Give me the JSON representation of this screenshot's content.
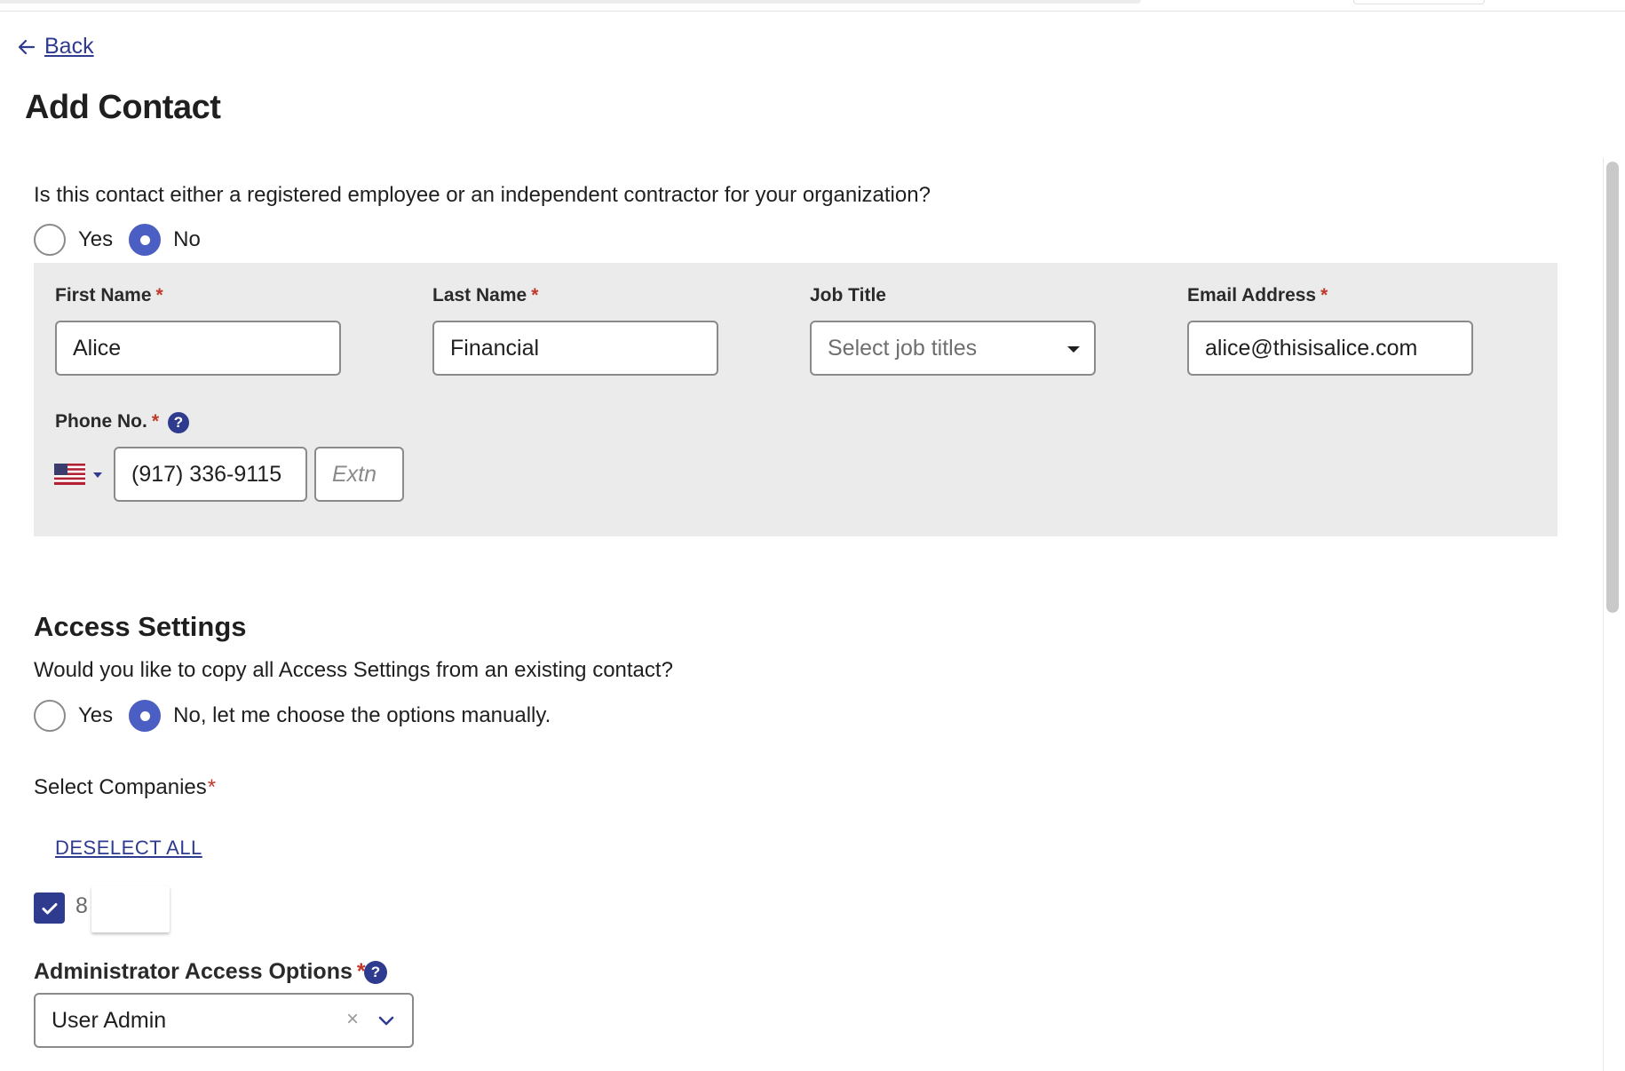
{
  "nav": {
    "back_label": "Back"
  },
  "page": {
    "title": "Add Contact"
  },
  "employee_question": {
    "text": "Is this contact either a registered employee or an independent contractor for your organization?",
    "options": [
      {
        "label": "Yes",
        "selected": false
      },
      {
        "label": "No",
        "selected": true
      }
    ]
  },
  "contact_form": {
    "first_name": {
      "label": "First Name",
      "required_mark": "*",
      "value": "Alice"
    },
    "last_name": {
      "label": "Last Name",
      "required_mark": "*",
      "value": "Financial"
    },
    "job_title": {
      "label": "Job Title",
      "placeholder": "Select job titles"
    },
    "email": {
      "label": "Email Address",
      "required_mark": "*",
      "value": "alice@thisisalice.com"
    },
    "phone": {
      "label": "Phone No.",
      "required_mark": "*",
      "help_icon": "?",
      "country_flag": "us-flag-icon",
      "value": "(917) 336-9115",
      "extension_placeholder": "Extn"
    }
  },
  "access_settings": {
    "heading": "Access Settings",
    "copy_question": "Would you like to copy all Access Settings from an existing contact?",
    "copy_options": [
      {
        "label": "Yes",
        "selected": false
      },
      {
        "label": "No, let me choose the options manually.",
        "selected": true
      }
    ],
    "companies": {
      "label": "Select Companies",
      "required_mark": "*",
      "deselect_all": "DESELECT ALL",
      "items": [
        {
          "text": "8",
          "checked": true
        }
      ]
    },
    "admin_access": {
      "label": "Administrator Access Options",
      "required_mark": "*",
      "help_icon": "?",
      "value": "User Admin",
      "clear_icon": "×"
    }
  },
  "colors": {
    "accent": "#4b5ec4",
    "link": "#2f3b8f",
    "required": "#c0392b",
    "panel": "#ebebeb"
  }
}
